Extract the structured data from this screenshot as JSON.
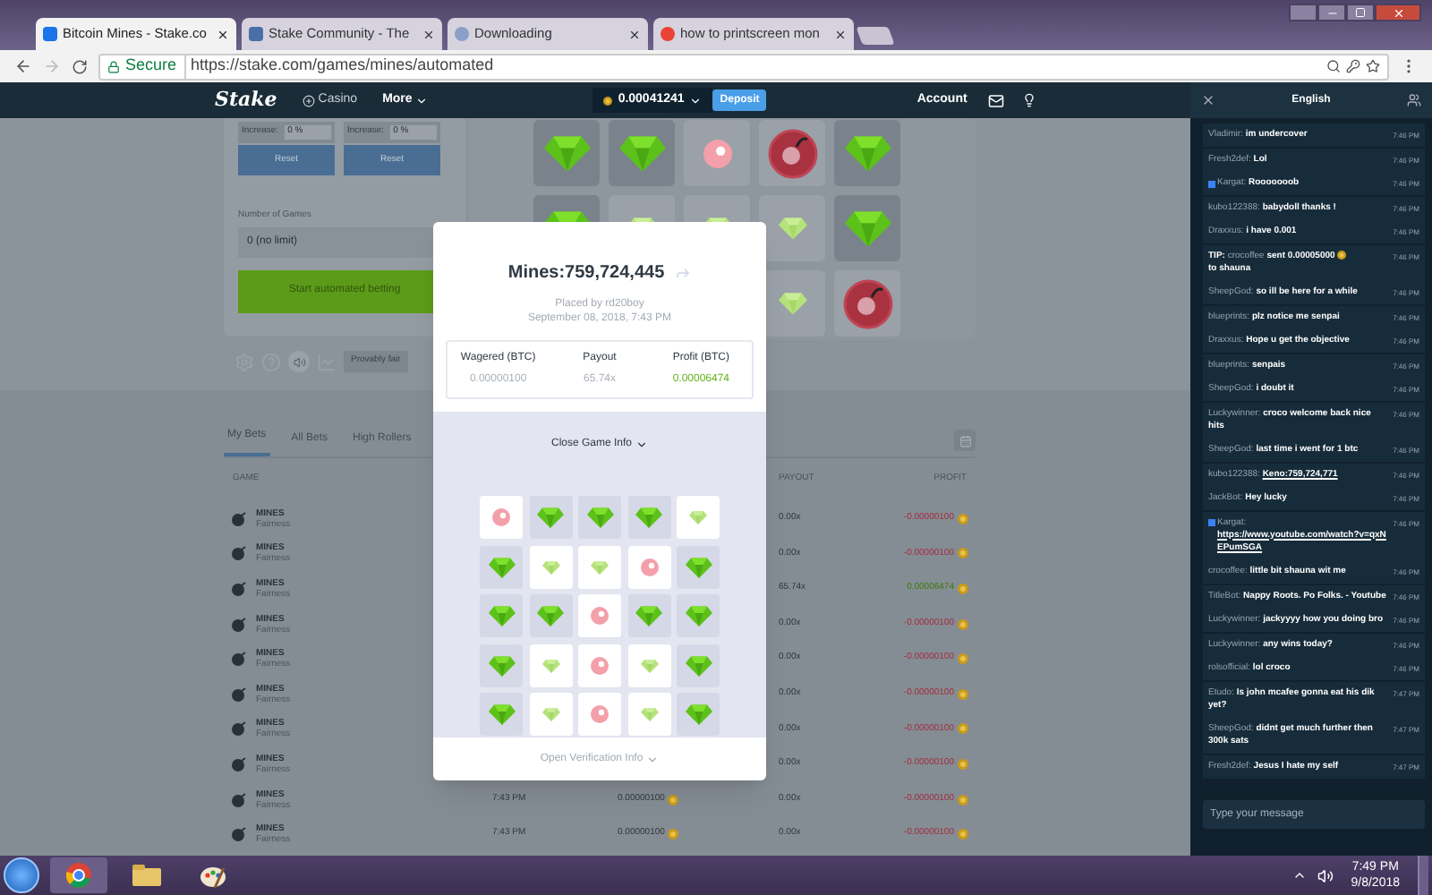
{
  "browser": {
    "tabs": [
      {
        "title": "Bitcoin Mines - Stake.co",
        "selected": true
      },
      {
        "title": "Stake Community - The",
        "selected": false
      },
      {
        "title": "Downloading",
        "selected": false
      },
      {
        "title": "how to printscreen mon",
        "selected": false
      }
    ],
    "secure_label": "Secure",
    "url": "https://stake.com/games/mines/automated"
  },
  "site_header": {
    "logo": "Stake",
    "nav": [
      "Casino",
      "More"
    ],
    "balance": "0.00041241",
    "deposit": "Deposit",
    "account": "Account"
  },
  "auto_panel": {
    "adjusters": [
      {
        "label": "Increase:",
        "value": "0 %",
        "button": "Reset"
      },
      {
        "label": "Increase:",
        "value": "0 %",
        "button": "Reset"
      }
    ],
    "games_label": "Number of Games",
    "games_value": "0 (no limit)",
    "start": "Start automated betting",
    "provably_fair": "Provably fair"
  },
  "board": [
    [
      {
        "kind": "gem"
      },
      {
        "kind": "gem"
      },
      {
        "kind": "mine_faint"
      },
      {
        "kind": "mine"
      },
      {
        "kind": "gem"
      }
    ],
    [
      {
        "kind": "gem"
      },
      {
        "kind": "gem_faint"
      },
      {
        "kind": "gem_faint"
      },
      {
        "kind": "gem_faint"
      },
      {
        "kind": "gem"
      }
    ],
    [
      {
        "kind": "gem_faint"
      },
      {
        "kind": "mine"
      }
    ]
  ],
  "bets": {
    "tabs": [
      {
        "label": "My Bets",
        "selected": true
      },
      {
        "label": "All Bets",
        "selected": false
      },
      {
        "label": "High Rollers",
        "selected": false
      }
    ],
    "columns": {
      "game": "GAME",
      "payout": "PAYOUT",
      "profit": "PROFIT"
    },
    "rows": [
      {
        "game": "MINES",
        "link": "Fairness",
        "payout": "0.00x",
        "profit": "-0.00000100",
        "kind": "loss"
      },
      {
        "game": "MINES",
        "link": "Fairness",
        "payout": "0.00x",
        "profit": "-0.00000100",
        "kind": "loss"
      },
      {
        "game": "MINES",
        "link": "Fairness",
        "payout": "65.74x",
        "profit": "0.00006474",
        "kind": "win"
      },
      {
        "game": "MINES",
        "link": "Fairness",
        "payout": "0.00x",
        "profit": "-0.00000100",
        "kind": "loss"
      },
      {
        "game": "MINES",
        "link": "Fairness",
        "payout": "0.00x",
        "profit": "-0.00000100",
        "kind": "loss"
      },
      {
        "game": "MINES",
        "link": "Fairness",
        "payout": "0.00x",
        "profit": "-0.00000100",
        "kind": "loss"
      },
      {
        "game": "MINES",
        "link": "Fairness",
        "payout": "0.00x",
        "profit": "-0.00000100",
        "kind": "loss"
      },
      {
        "game": "MINES",
        "link": "Fairness",
        "payout": "0.00x",
        "profit": "-0.00000100",
        "kind": "loss"
      },
      {
        "game": "MINES",
        "link": "Fairness",
        "time": "7:43 PM",
        "bet": "0.00000100",
        "payout": "0.00x",
        "profit": "-0.00000100",
        "kind": "loss"
      },
      {
        "game": "MINES",
        "link": "Fairness",
        "time": "7:43 PM",
        "bet": "0.00000100",
        "payout": "0.00x",
        "profit": "-0.00000100",
        "kind": "loss"
      }
    ]
  },
  "modal": {
    "title": "Mines:759,724,445",
    "placed_by": "Placed by rd20boy",
    "date": "September 08, 2018, 7:43 PM",
    "stats": [
      {
        "label": "Wagered (BTC)",
        "value": "0.00000100",
        "kind": "muted"
      },
      {
        "label": "Payout",
        "value": "65.74x",
        "kind": "muted"
      },
      {
        "label": "Profit (BTC)",
        "value": "0.00006474",
        "kind": "win"
      }
    ],
    "close_info": "Close Game Info",
    "grid": [
      [
        {
          "kind": "mine_faint"
        },
        {
          "kind": "gem"
        },
        {
          "kind": "gem"
        },
        {
          "kind": "gem"
        },
        {
          "kind": "gem_faint"
        }
      ],
      [
        {
          "kind": "gem"
        },
        {
          "kind": "gem_faint"
        },
        {
          "kind": "gem_faint"
        },
        {
          "kind": "mine_faint"
        },
        {
          "kind": "gem"
        }
      ],
      [
        {
          "kind": "gem"
        },
        {
          "kind": "gem"
        },
        {
          "kind": "mine_faint"
        },
        {
          "kind": "gem"
        },
        {
          "kind": "gem"
        }
      ],
      [
        {
          "kind": "gem"
        },
        {
          "kind": "gem_faint"
        },
        {
          "kind": "mine_faint"
        },
        {
          "kind": "gem_faint"
        },
        {
          "kind": "gem"
        }
      ],
      [
        {
          "kind": "gem"
        },
        {
          "kind": "gem_faint"
        },
        {
          "kind": "mine_faint"
        },
        {
          "kind": "gem_faint"
        },
        {
          "kind": "gem"
        }
      ]
    ],
    "verification": "Open Verification Info"
  },
  "chat": {
    "language": "English",
    "placeholder": "Type your message",
    "messages": [
      {
        "user": "Vladimir:",
        "text": "im undercover",
        "time": "7:46 PM"
      },
      {
        "user": "Fresh2def:",
        "text": "Lol",
        "time": "7:46 PM"
      },
      {
        "user": "Kargat:",
        "text": "Rooooooob",
        "time": "7:46 PM",
        "badge": true
      },
      {
        "user": "kubo122388:",
        "text": "babydoll thanks !",
        "time": "7:46 PM"
      },
      {
        "user": "Draxxus:",
        "text": "i have 0.001",
        "time": "7:46 PM"
      },
      {
        "kind": "tip",
        "label": "TIP:",
        "user": "crocoffee",
        "text": "sent 0.00005000",
        "after": "to shauna",
        "time": "7:46 PM"
      },
      {
        "user": "SheepGod:",
        "text": "so ill be here for a while",
        "time": "7:46 PM"
      },
      {
        "user": "blueprints:",
        "text": "plz notice me senpai",
        "time": "7:46 PM"
      },
      {
        "user": "Draxxus:",
        "text": "Hope u get the objective",
        "time": "7:46 PM"
      },
      {
        "user": "blueprints:",
        "text": "senpais",
        "time": "7:46 PM"
      },
      {
        "user": "SheepGod:",
        "text": "i doubt it",
        "time": "7:46 PM"
      },
      {
        "user": "Luckywinner:",
        "text": "croco welcome back nice hits",
        "time": "7:46 PM"
      },
      {
        "user": "SheepGod:",
        "text": "last time i went for 1 btc",
        "time": "7:46 PM"
      },
      {
        "kind": "link",
        "user": "kubo122388:",
        "text": "Keno:759,724,771",
        "time": "7:46 PM"
      },
      {
        "user": "JackBot:",
        "text": "Hey lucky",
        "time": "7:46 PM"
      },
      {
        "kind": "link",
        "user": "Kargat:",
        "text": "https://www.youtube.com/watch?v=qxNEPumSGA",
        "time": "7:46 PM",
        "badge": true
      },
      {
        "user": "crocoffee:",
        "text": "little bit shauna wit me",
        "time": "7:46 PM"
      },
      {
        "user": "TitleBot:",
        "text": "Nappy Roots. Po Folks. - Youtube",
        "time": "7:46 PM"
      },
      {
        "user": "Luckywinner:",
        "text": "jackyyyy how you doing bro",
        "time": "7:46 PM"
      },
      {
        "user": "Luckywinner:",
        "text": "any wins today?",
        "time": "7:46 PM"
      },
      {
        "user": "rolsofficial:",
        "text": "lol croco",
        "time": "7:46 PM"
      },
      {
        "user": "Etudo:",
        "text": "Is john mcafee gonna eat his dik yet?",
        "time": "7:47 PM"
      },
      {
        "user": "SheepGod:",
        "text": "didnt get much further then 300k sats",
        "time": "7:47 PM"
      },
      {
        "user": "Fresh2def:",
        "text": "Jesus I hate my self",
        "time": "7:47 PM"
      }
    ]
  },
  "taskbar": {
    "time": "7:49 PM",
    "date": "9/8/2018"
  }
}
